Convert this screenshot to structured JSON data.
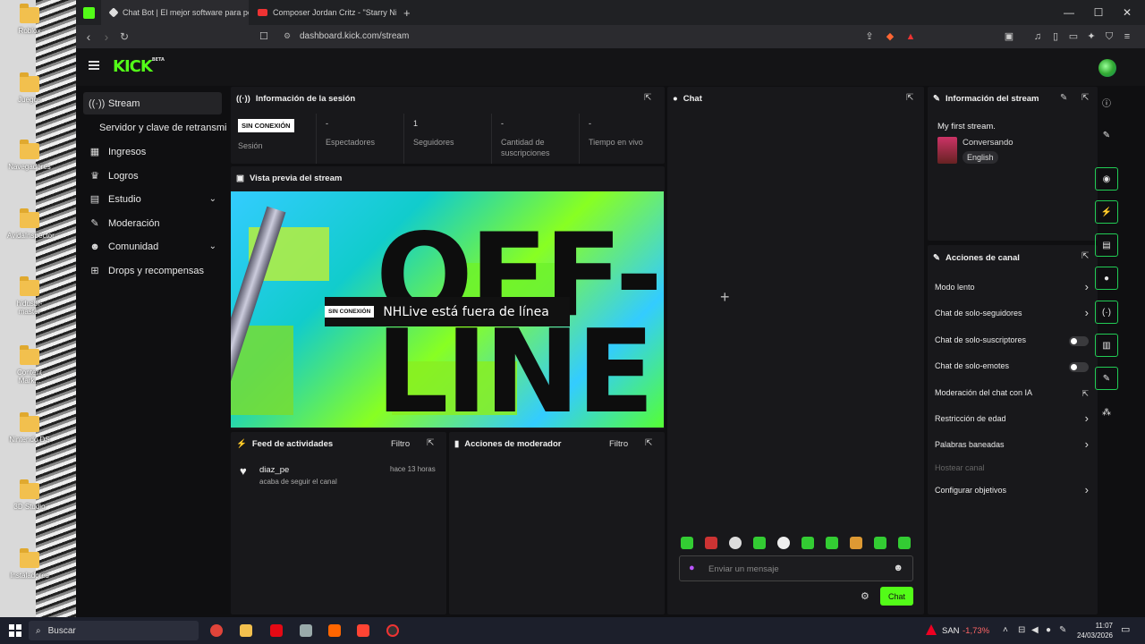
{
  "desktop": {
    "icons": [
      "Roblox",
      "Juegos",
      "Navegadores",
      "AvidaInspector",
      "hidusbf-master",
      "Content Mark...",
      "Nintendo DS",
      "3D Studio",
      "Instaladores"
    ]
  },
  "browser": {
    "tabs": [
      {
        "label": "Chat Bot | El mejor software para pot"
      },
      {
        "label": "Composer Jordan Critz - \"Starry Nigh"
      }
    ],
    "new_tab": "+",
    "url": "dashboard.kick.com/stream",
    "controls": {
      "minimize": "—",
      "maximize": "☐",
      "close": "✕"
    }
  },
  "kick": {
    "logo": "KICK",
    "logo_sup": "BETA",
    "sidebar": [
      {
        "label": "Stream",
        "icon": "stream-icon",
        "active": true
      },
      {
        "label": "Servidor y clave de retransmi",
        "icon": "",
        "active": false
      },
      {
        "label": "Ingresos",
        "icon": "wallet-icon",
        "active": false
      },
      {
        "label": "Logros",
        "icon": "trophy-icon",
        "active": false
      },
      {
        "label": "Estudio",
        "icon": "studio-icon",
        "active": false,
        "chevron": true
      },
      {
        "label": "Moderación",
        "icon": "wrench-icon",
        "active": false
      },
      {
        "label": "Comunidad",
        "icon": "people-icon",
        "active": false,
        "chevron": true
      },
      {
        "label": "Drops y recompensas",
        "icon": "gift-icon",
        "active": false
      }
    ],
    "session": {
      "title": "Información de la sesión",
      "badge": "SIN CONEXIÓN",
      "stats": [
        {
          "value": "",
          "label": "Sesión"
        },
        {
          "value": "-",
          "label": "Espectadores"
        },
        {
          "value": "1",
          "label": "Seguidores"
        },
        {
          "value": "-",
          "label": "Cantidad de suscripciones"
        },
        {
          "value": "-",
          "label": "Tiempo en vivo"
        }
      ]
    },
    "preview": {
      "title": "Vista previa del stream",
      "big_top": "OFF-",
      "big_bottom": "LINE",
      "badge": "SIN CONEXIÓN",
      "message": "NHLive está fuera de línea"
    },
    "activity": {
      "title": "Feed de actividades",
      "filter": "Filtro",
      "items": [
        {
          "user": "diaz_pe",
          "text": "acaba de seguir el canal",
          "time": "hace 13 horas"
        }
      ]
    },
    "modactions": {
      "title": "Acciones de moderador",
      "filter": "Filtro"
    },
    "chat": {
      "title": "Chat",
      "placeholder": "Enviar un mensaje",
      "send": "Chat"
    },
    "streaminfo": {
      "title": "Información del stream",
      "stream_title": "My first stream.",
      "category": "Conversando",
      "language": "English"
    },
    "channel_actions": {
      "title": "Acciones de canal",
      "items": [
        {
          "label": "Modo lento",
          "type": "arrow"
        },
        {
          "label": "Chat de solo-seguidores",
          "type": "arrow"
        },
        {
          "label": "Chat de solo-suscriptores",
          "type": "toggle"
        },
        {
          "label": "Chat de solo-emotes",
          "type": "toggle"
        },
        {
          "label": "Moderación del chat con IA",
          "type": "external"
        },
        {
          "label": "Restricción de edad",
          "type": "arrow"
        },
        {
          "label": "Palabras baneadas",
          "type": "arrow"
        },
        {
          "label": "Hostear canal",
          "type": "disabled"
        },
        {
          "label": "Configurar objetivos",
          "type": "arrow"
        }
      ]
    }
  },
  "taskbar": {
    "search": "Buscar",
    "stock_ticker": "SAN",
    "stock_change": "-1,73%",
    "time": "11:07",
    "date": "24/03/2026"
  },
  "colors": {
    "kick_green": "#53fc18",
    "panel": "#18181b",
    "bg": "#0f0f11"
  }
}
